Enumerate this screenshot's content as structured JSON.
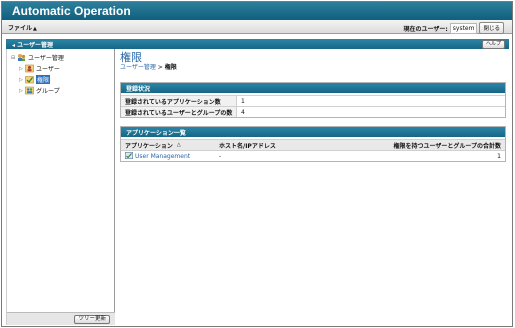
{
  "window": {
    "title": "Automatic Operation"
  },
  "menu": {
    "file_label": "ファイル",
    "caret": "▲"
  },
  "user": {
    "label": "現在のユーザー:",
    "name": "system",
    "close_label": "閉じる"
  },
  "panel": {
    "title": "ユーザー管理",
    "help_label": "ヘルプ"
  },
  "tree": {
    "root": {
      "label": "ユーザー管理",
      "icon": "user-admin-icon"
    },
    "items": [
      {
        "label": "ユーザー",
        "icon": "users-icon",
        "selected": false
      },
      {
        "label": "権限",
        "icon": "permission-icon",
        "selected": true
      },
      {
        "label": "グループ",
        "icon": "group-icon",
        "selected": false
      }
    ],
    "refresh_label": "ツリー更新"
  },
  "main": {
    "title": "権限",
    "breadcrumb": {
      "parent": "ユーザー管理",
      "sep": " > ",
      "current": "権限"
    }
  },
  "registration": {
    "heading": "登録状況",
    "rows": [
      {
        "key": "登録されているアプリケーション数",
        "value": "1"
      },
      {
        "key": "登録されているユーザーとグループの数",
        "value": "4"
      }
    ]
  },
  "app_list": {
    "heading": "アプリケーション一覧",
    "columns": [
      "アプリケーション",
      "ホスト名/IPアドレス",
      "権限を持つユーザーとグループの合計数"
    ],
    "sort_indicator": "△",
    "rows": [
      {
        "app": "User Management",
        "host": "-",
        "count": "1"
      }
    ]
  },
  "colors": {
    "accent": "#176686",
    "link": "#2766a8",
    "selected": "#2c6fbf"
  }
}
